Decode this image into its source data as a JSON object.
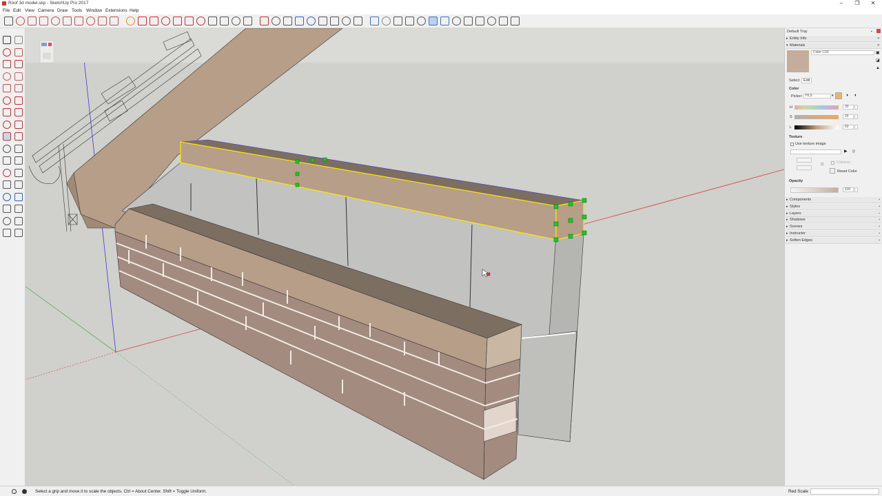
{
  "window": {
    "title": "Roof 3d model.skp - SketchUp Pro 2017",
    "minimize_glyph": "–",
    "maximize_glyph": "❐",
    "close_glyph": "✕"
  },
  "menu": {
    "items": [
      "File",
      "Edit",
      "View",
      "Camera",
      "Draw",
      "Tools",
      "Window",
      "Extensions",
      "Help"
    ]
  },
  "toolbar": {
    "icons": [
      "select-icon",
      "eraser-icon",
      "line-icon",
      "freehand-icon",
      "rectangle-icon",
      "circle-icon",
      "polygon-icon",
      "arc-icon",
      "pie-icon",
      "arc3-icon",
      "paint-icon",
      "move-icon",
      "rotate-icon",
      "scale-icon",
      "followme-icon",
      "offset-icon",
      "pushpull-icon",
      "tape-icon",
      "dimension-icon",
      "protractor-icon",
      "text-icon",
      "axes-icon",
      "orbit-icon",
      "pan-icon",
      "zoom-icon",
      "zoom-window-icon",
      "zoom-extents-icon",
      "footprint-icon",
      "lookaround-icon",
      "walk-icon",
      "xray-icon",
      "backedges-icon",
      "wireframe-icon",
      "hiddenline-icon",
      "shaded-icon",
      "textured-icon",
      "monochrome-icon",
      "iso-icon",
      "top-view-icon",
      "front-view-icon",
      "right-view-icon",
      "back-view-icon",
      "left-view-icon"
    ]
  },
  "tray": {
    "title": "Default Tray",
    "entity_info": "Entity Info",
    "materials": "Materials",
    "material_name": "Color C03",
    "tab_select": "Select",
    "tab_edit": "Edit",
    "color_heading": "Color",
    "picker_label": "Picker:",
    "picker_value": "HLS",
    "h_label": "H",
    "s_label": "S",
    "l_label": "L",
    "h_value": "30",
    "s_value": "26",
    "l_value": "69",
    "texture_heading": "Texture",
    "use_texture_label": "Use texture image",
    "colorize_label": "Colorize",
    "reset_color_label": "Reset Color",
    "opacity_heading": "Opacity",
    "opacity_value": "100",
    "swatch_color": "#c4ad9a",
    "panels": [
      "Components",
      "Styles",
      "Layers",
      "Shadows",
      "Scenes",
      "Instructor",
      "Soften Edges"
    ]
  },
  "status": {
    "hint": "Select a grip and move it to scale the objects. Ctrl = About Center. Shift = Toggle Uniform.",
    "measure_label": "Red Scale",
    "measure_value": ""
  },
  "colors": {
    "selection": "#ffe600",
    "grip": "#1ec81e",
    "red_axis": "#d83a3a",
    "green_axis": "#3fa83f",
    "blue_axis": "#3a3ad8",
    "wood": "#b69e88",
    "brick": "#a38b80"
  }
}
